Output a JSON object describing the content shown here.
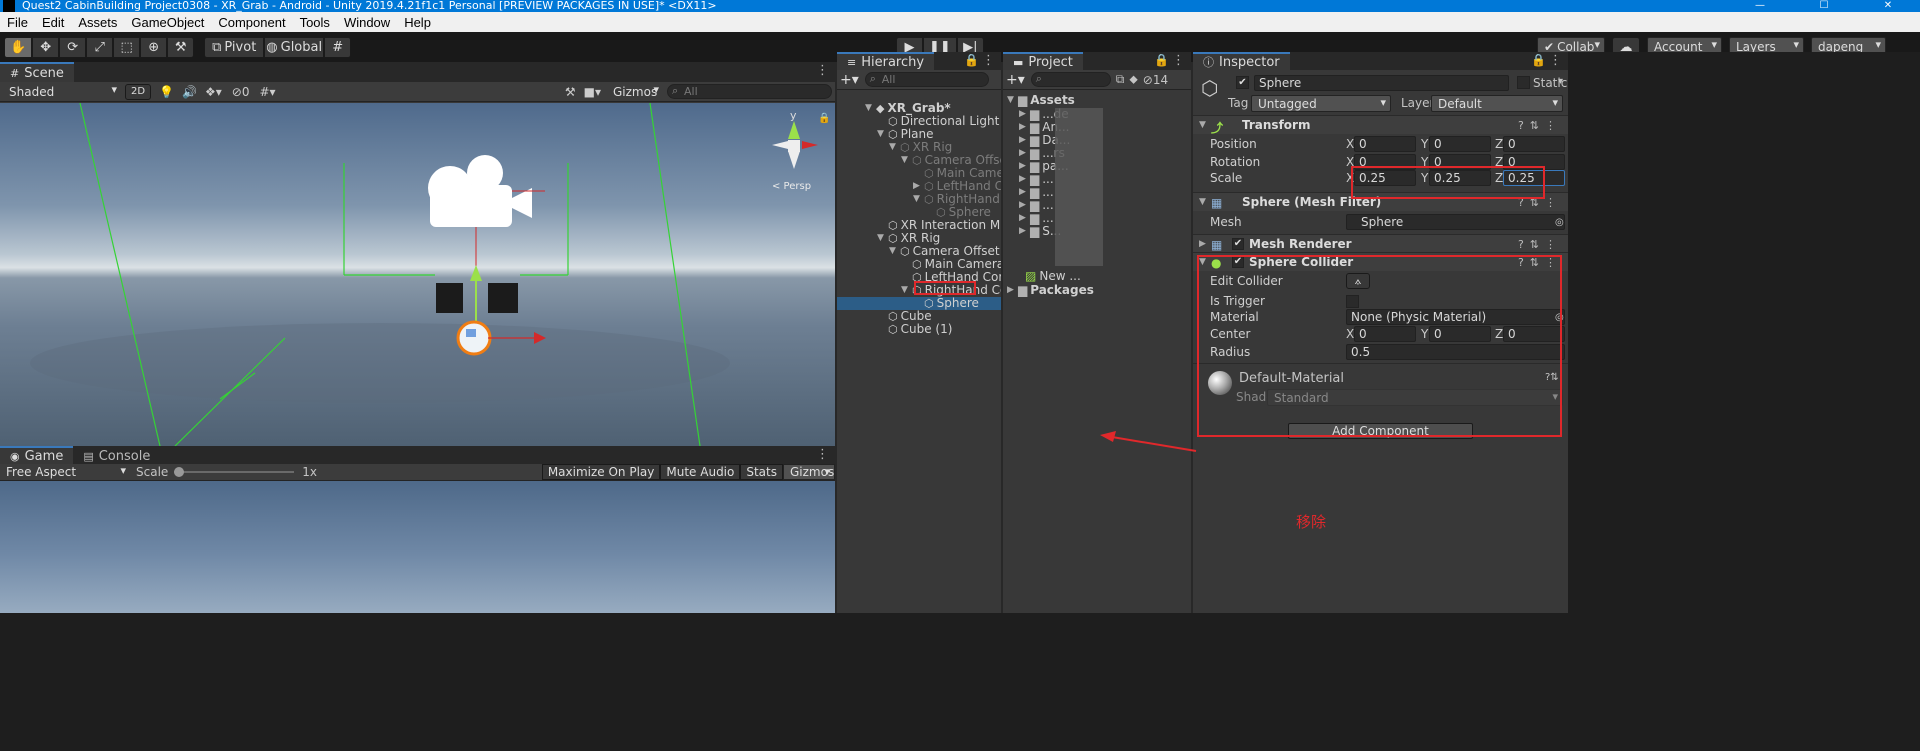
{
  "window": {
    "title": "Quest2 CabinBuilding Project0308 - XR_Grab - Android - Unity 2019.4.21f1c1 Personal [PREVIEW PACKAGES IN USE]* <DX11>"
  },
  "menu": [
    "File",
    "Edit",
    "Assets",
    "GameObject",
    "Component",
    "Tools",
    "Window",
    "Help"
  ],
  "toolbar": {
    "tools": [
      "hand-icon",
      "move-icon",
      "rotate-icon",
      "scale-icon",
      "rect-icon",
      "transform-icon",
      "custom-tool-icon"
    ],
    "pivot": "Pivot",
    "global": "Global",
    "collab": "Collab",
    "account": "Account",
    "layers": "Layers",
    "layout": "dapeng"
  },
  "scene": {
    "tab": "Scene",
    "shading": "Shaded",
    "mode2d": "2D",
    "hidden_count": "0",
    "gizmos": "Gizmos",
    "search_placeholder": "All",
    "axis_y": "y",
    "persp_label": "< Persp"
  },
  "game": {
    "tabs": [
      "Game",
      "Console"
    ],
    "aspect": "Free Aspect",
    "scale_label": "Scale",
    "scale_value": "1x",
    "toggles": [
      "Maximize On Play",
      "Mute Audio",
      "Stats",
      "Gizmos"
    ]
  },
  "hierarchy": {
    "tab": "Hierarchy",
    "search_placeholder": "All",
    "items": [
      {
        "label": "XR_Grab*",
        "depth": 0,
        "arrow": "open",
        "root": true
      },
      {
        "label": "Directional Light",
        "depth": 1,
        "arrow": "none"
      },
      {
        "label": "Plane",
        "depth": 1,
        "arrow": "open"
      },
      {
        "label": "XR Rig",
        "depth": 2,
        "arrow": "open",
        "dim": true
      },
      {
        "label": "Camera Offset",
        "depth": 3,
        "arrow": "open",
        "dim": true
      },
      {
        "label": "Main Camera",
        "depth": 4,
        "arrow": "none",
        "dim": true
      },
      {
        "label": "LeftHand Con",
        "depth": 4,
        "arrow": "closed",
        "dim": true
      },
      {
        "label": "RightHand Co",
        "depth": 4,
        "arrow": "open",
        "dim": true
      },
      {
        "label": "Sphere",
        "depth": 5,
        "arrow": "none",
        "dim": true
      },
      {
        "label": "XR Interaction Manag",
        "depth": 1,
        "arrow": "none"
      },
      {
        "label": "XR Rig",
        "depth": 1,
        "arrow": "open"
      },
      {
        "label": "Camera Offset",
        "depth": 2,
        "arrow": "open"
      },
      {
        "label": "Main Camera",
        "depth": 3,
        "arrow": "none"
      },
      {
        "label": "LeftHand Contro",
        "depth": 3,
        "arrow": "none"
      },
      {
        "label": "RightHand Contr",
        "depth": 3,
        "arrow": "open"
      },
      {
        "label": "Sphere",
        "depth": 4,
        "arrow": "none",
        "selected": true
      },
      {
        "label": "Cube",
        "depth": 1,
        "arrow": "none"
      },
      {
        "label": "Cube (1)",
        "depth": 1,
        "arrow": "none"
      }
    ]
  },
  "project": {
    "tab": "Project",
    "count": "14",
    "root": "Assets",
    "items": [
      {
        "label": "...de",
        "partial": true
      },
      {
        "label": "An...",
        "partial": true
      },
      {
        "label": "Da...",
        "partial": true
      },
      {
        "label": "...rs",
        "partial": true
      },
      {
        "label": "pa...",
        "partial": true
      },
      {
        "label": "...",
        "partial": true
      },
      {
        "label": "...",
        "partial": true
      },
      {
        "label": "...",
        "partial": true
      },
      {
        "label": "...",
        "partial": true
      },
      {
        "label": "S...",
        "partial": true
      }
    ],
    "new_item": "New ...",
    "packages": "Packages"
  },
  "inspector": {
    "tab": "Inspector",
    "object_name": "Sphere",
    "static": "Static",
    "tag_label": "Tag",
    "tag_value": "Untagged",
    "layer_label": "Layer",
    "layer_value": "Default",
    "transform": {
      "title": "Transform",
      "position_label": "Position",
      "rotation_label": "Rotation",
      "scale_label": "Scale",
      "position": {
        "x": "0",
        "y": "0",
        "z": "0"
      },
      "rotation": {
        "x": "0",
        "y": "0",
        "z": "0"
      },
      "scale": {
        "x": "0.25",
        "y": "0.25",
        "z": "0.25"
      }
    },
    "mesh_filter": {
      "title": "Sphere (Mesh Filter)",
      "mesh_label": "Mesh",
      "mesh_value": "Sphere"
    },
    "mesh_renderer": {
      "title": "Mesh Renderer"
    },
    "sphere_collider": {
      "title": "Sphere Collider",
      "edit_label": "Edit Collider",
      "trigger_label": "Is Trigger",
      "material_label": "Material",
      "material_value": "None (Physic Material)",
      "center_label": "Center",
      "center": {
        "x": "0",
        "y": "0",
        "z": "0"
      },
      "radius_label": "Radius",
      "radius_value": "0.5"
    },
    "material": {
      "name": "Default-Material",
      "shader_label": "Shader",
      "shader_value": "Standard"
    },
    "add_component": "Add Component",
    "axis": {
      "x": "X",
      "y": "Y",
      "z": "Z"
    }
  },
  "annotation": {
    "text": "移除",
    "color": "#e0282b"
  }
}
